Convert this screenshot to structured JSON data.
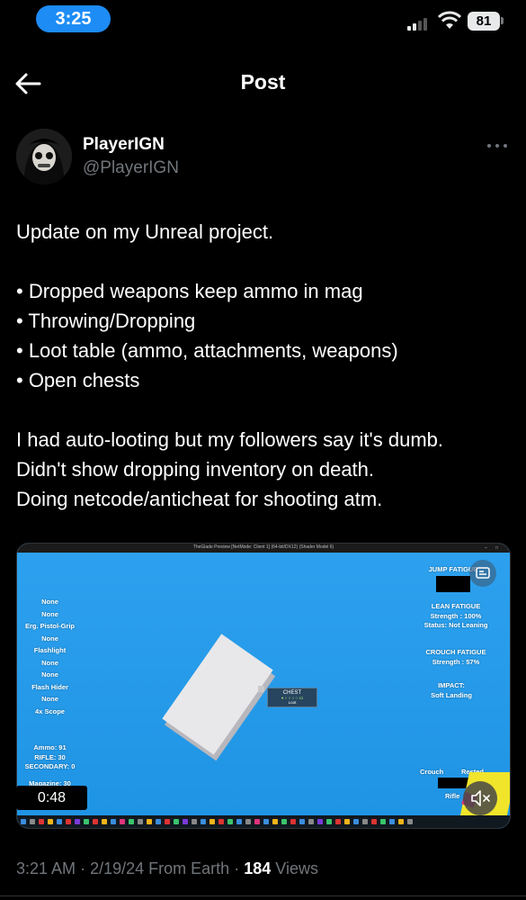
{
  "status_bar": {
    "time": "3:25",
    "battery": "81"
  },
  "header": {
    "title": "Post"
  },
  "author": {
    "display_name": "PlayerIGN",
    "handle": "@PlayerIGN"
  },
  "post": {
    "lines": [
      "Update on my Unreal project.",
      "",
      "• Dropped weapons keep ammo in mag",
      "• Throwing/Dropping",
      "• Loot table (ammo, attachments, weapons)",
      "• Open chests",
      "",
      "I had auto-looting but my followers say it's dumb.",
      "Didn't show dropping inventory on death.",
      "Doing netcode/anticheat for shooting atm."
    ]
  },
  "media": {
    "window_title": "TheGlade Preview [NetMode: Client 1] (64-bit/DX12) (Shader Model 6)",
    "hud_left": [
      "None",
      "None",
      "Erg. Pistol-Grip",
      "None",
      "Flashlight",
      "None",
      "None",
      "Flash Hider",
      "None",
      "4x Scope"
    ],
    "ammo": [
      "Ammo: 91",
      "RIFLE: 30",
      "SECONDARY: 0"
    ],
    "magazine": "Magazine: 30",
    "jump_fatigue": "JUMP FATIGUE",
    "lean_fatigue": [
      "LEAN FATIGUE",
      "Strength : 100%",
      "Status: Not Leaning"
    ],
    "crouch_fatigue": [
      "CROUCH FATIGUE",
      "Strength : 57%"
    ],
    "impact": [
      "IMPACT:",
      "Soft Landing"
    ],
    "stance": {
      "crouch": "Crouch",
      "rested": "Rested",
      "rifle": "Rifle"
    },
    "chest_label": {
      "title": "CHEST",
      "stars": "● ○ ○ ○ ○  x1",
      "sub": "Loot"
    },
    "timer": "0:48"
  },
  "meta": {
    "time": "3:21 AM",
    "date": "2/19/24",
    "source": "From Earth",
    "views_count": "184",
    "views_label": "Views",
    "sep": "·"
  },
  "colors": {
    "accent": "#1d8cf5",
    "secondary_text": "#71767b",
    "game_sky": "#1f95e6"
  }
}
